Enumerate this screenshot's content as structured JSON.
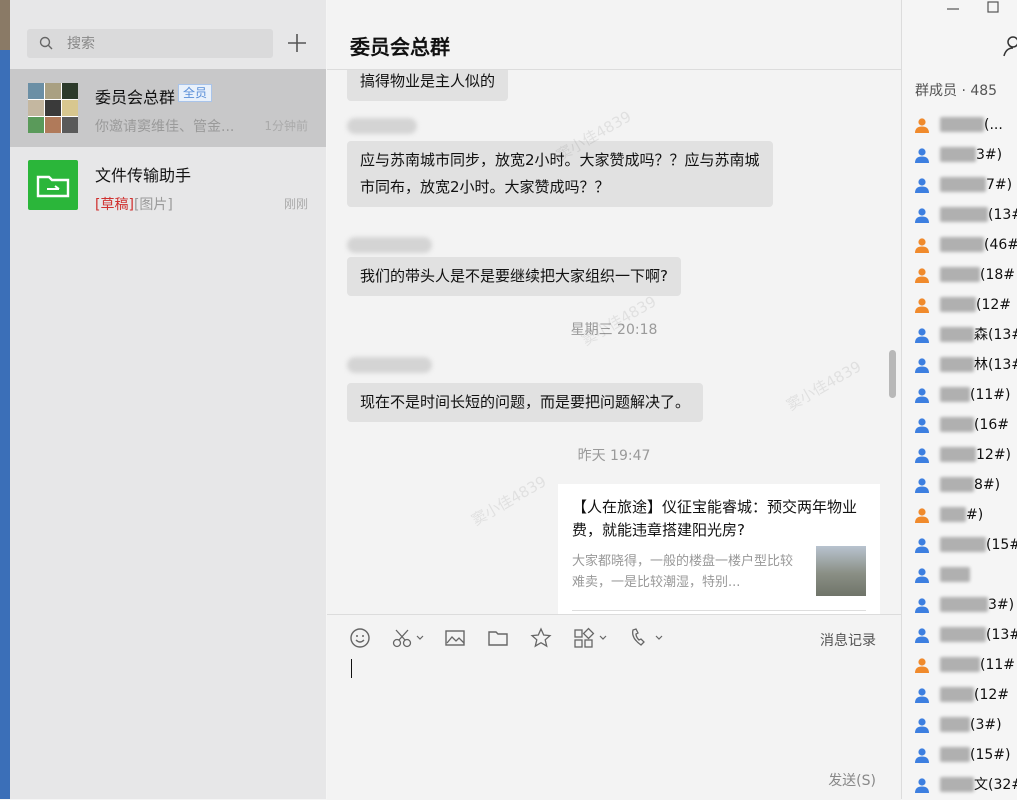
{
  "search": {
    "placeholder": "搜索"
  },
  "conversations": [
    {
      "name": "委员会总群",
      "badge": "全员",
      "preview": "你邀请窦维佳、管金...",
      "time": "1分钟前"
    },
    {
      "name": "文件传输助手",
      "draft": "[草稿]",
      "preview": "[图片]",
      "time": "刚刚"
    }
  ],
  "chat": {
    "title": "委员会总群",
    "messages": [
      {
        "text": "搞得物业是主人似的"
      },
      {
        "text": "应与苏南城市同步，放宽2小时。大家赞成吗？？应与苏南城市同布，放宽2小时。大家赞成吗？？"
      },
      {
        "text": "我们的带头人是不是要继续把大家组织一下啊?"
      },
      {
        "text": "现在不是时间长短的问题，而是要把问题解决了。"
      }
    ],
    "timestamps": [
      "星期三 20:18",
      "昨天 19:47"
    ],
    "card": {
      "title": "【人在旅途】仪征宝能睿城：预交两年物业费，就能违章搭建阳光房?",
      "desc": "大家都晓得，一般的楼盘一楼户型比较难卖，一是比较潮湿，特别..."
    },
    "watermark": "窦小佳4839"
  },
  "toolbar": {
    "history": "消息记录",
    "send": "发送(S)"
  },
  "members": {
    "header": "群成员 · 485",
    "list": [
      {
        "suffix": "(...",
        "color": "orange"
      },
      {
        "suffix": "3#)",
        "color": "blue"
      },
      {
        "suffix": "7#)",
        "color": "blue"
      },
      {
        "suffix": "(13#",
        "color": "blue"
      },
      {
        "suffix": "(46#",
        "color": "orange"
      },
      {
        "suffix": "(18#",
        "color": "orange"
      },
      {
        "suffix": "(12#",
        "color": "orange"
      },
      {
        "suffix": "森(13#",
        "color": "blue"
      },
      {
        "suffix": "林(13#",
        "color": "blue"
      },
      {
        "suffix": "(11#)",
        "color": "blue"
      },
      {
        "suffix": "(16#",
        "color": "blue"
      },
      {
        "suffix": "12#)",
        "color": "blue"
      },
      {
        "suffix": "8#)",
        "color": "blue"
      },
      {
        "suffix": "#)",
        "color": "orange"
      },
      {
        "suffix": "(15#",
        "color": "blue"
      },
      {
        "suffix": "",
        "color": "blue"
      },
      {
        "suffix": "3#)",
        "color": "blue"
      },
      {
        "suffix": "(13#",
        "color": "blue"
      },
      {
        "suffix": "(11#",
        "color": "orange"
      },
      {
        "suffix": "(12#",
        "color": "blue"
      },
      {
        "suffix": "(3#)",
        "color": "blue"
      },
      {
        "suffix": "(15#)",
        "color": "blue"
      },
      {
        "suffix": "文(32#",
        "color": "blue"
      }
    ]
  },
  "colors": {
    "member_blue": "#3d7fe0",
    "member_orange": "#f08a2c",
    "file_green": "#2bb63a",
    "draft_red": "#d0302f"
  }
}
